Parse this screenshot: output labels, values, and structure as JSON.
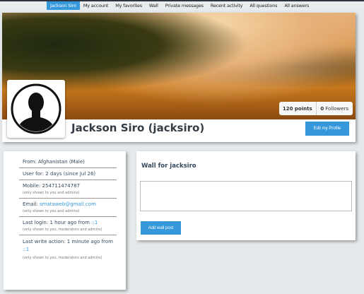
{
  "nav": {
    "items": [
      "Jackson Siro",
      "My account",
      "My favorites",
      "Wall",
      "Private messages",
      "Recent activity",
      "All questions",
      "All answers"
    ]
  },
  "profile": {
    "name": "Jackson Siro (jacksiro)",
    "points": "120 points",
    "followers_count": "0",
    "followers_label": "Followers",
    "edit_label": "Edit my Profile"
  },
  "info": {
    "from": "From: Afghanistan (Male)",
    "user_for": "User for: 2 days (since Jul 26)",
    "mobile": "Mobile: 254711474787",
    "mobile_note": "(only shown to you and admins)",
    "email_label": "Email: ",
    "email": "smataweb@gmail.com",
    "email_note": "(only shown to you and admins)",
    "login_label": "Last login: 1 hour ago from ",
    "login_ip": "::1",
    "login_note": "(only shown to you, moderators and admins)",
    "write_label": "Last write action: 1 minute ago from ",
    "write_ip": "::1",
    "write_note": "(only shown to you, moderators and admins)"
  },
  "wall": {
    "title": "Wall for jacksiro",
    "textarea_value": "",
    "add_label": "Add wall post"
  }
}
